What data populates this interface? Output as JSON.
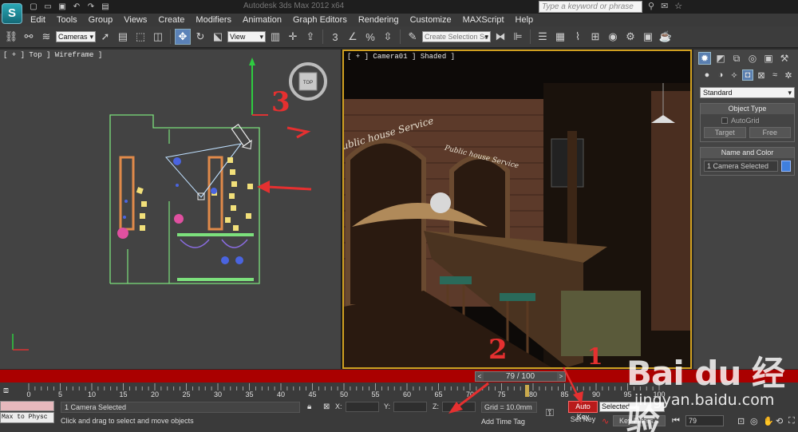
{
  "app": {
    "title": "Autodesk 3ds Max 2012 x64"
  },
  "help_search": {
    "placeholder": "Type a keyword or phrase"
  },
  "menu": [
    "Edit",
    "Tools",
    "Group",
    "Views",
    "Create",
    "Modifiers",
    "Animation",
    "Graph Editors",
    "Rendering",
    "Customize",
    "MAXScript",
    "Help"
  ],
  "toolbar": {
    "filter_value": "Cameras",
    "coord_value": "View",
    "selection_set_placeholder": "Create Selection Se"
  },
  "viewports": {
    "top": {
      "label": "[ + ] Top ] Wireframe ]",
      "viewcube_label": "TOP"
    },
    "camera": {
      "label": "[ + ] Camera01 ] Shaded ]",
      "sign_left": "Public house Service",
      "sign_right": "Public house Service"
    }
  },
  "command_panel": {
    "category_value": "Standard",
    "object_type": {
      "title": "Object Type",
      "autogrid": "AutoGrid",
      "buttons": [
        "Target",
        "Free"
      ]
    },
    "name_color": {
      "title": "Name and Color",
      "name_value": "1 Camera Selected"
    },
    "colors": {
      "object_swatch": "#3f7fdd"
    }
  },
  "timeline": {
    "slider_text": "79 / 100",
    "current_frame": 79,
    "total_frames": 100,
    "tick_labels": [
      "0",
      "5",
      "10",
      "15",
      "20",
      "25",
      "30",
      "35",
      "40",
      "45",
      "50",
      "55",
      "60",
      "65",
      "70",
      "75",
      "80",
      "85",
      "90",
      "95",
      "100"
    ]
  },
  "status": {
    "maxscript_text": "Max to Physc",
    "selection_text": "1 Camera Selected",
    "prompt_text": "Click and drag to select and move objects",
    "coord_labels": [
      "X:",
      "Y:",
      "Z:"
    ],
    "grid_text": "Grid = 10.0mm",
    "add_time_tag": "Add Time Tag",
    "auto_key": "Auto Key",
    "set_key": "Set Key",
    "key_mode": "Selected",
    "key_filters": "Key Filters...",
    "frame_value": "79"
  },
  "annotations": [
    "3",
    "2",
    "1"
  ],
  "watermark": {
    "logo_text": "Bai du 经验",
    "url": "jingyan.baidu.com"
  },
  "colors": {
    "accent_red": "#e53030",
    "active_border": "#d0a020",
    "auto_key": "#b81b1b"
  }
}
